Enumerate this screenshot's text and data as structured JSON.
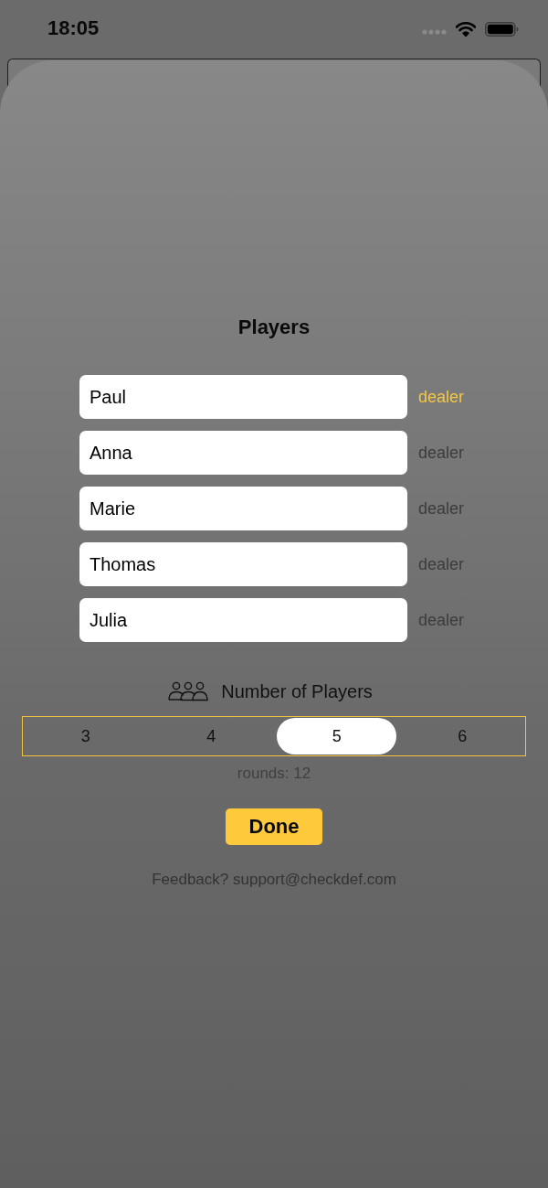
{
  "status_bar": {
    "time": "18:05"
  },
  "title": "Players",
  "players": [
    {
      "name": "Paul",
      "dealer_label": "dealer",
      "selected": true
    },
    {
      "name": "Anna",
      "dealer_label": "dealer",
      "selected": false
    },
    {
      "name": "Marie",
      "dealer_label": "dealer",
      "selected": false
    },
    {
      "name": "Thomas",
      "dealer_label": "dealer",
      "selected": false
    },
    {
      "name": "Julia",
      "dealer_label": "dealer",
      "selected": false
    }
  ],
  "player_count": {
    "label": "Number of Players",
    "options": [
      {
        "label": "3",
        "selected": false
      },
      {
        "label": "4",
        "selected": false
      },
      {
        "label": "5",
        "selected": true
      },
      {
        "label": "6",
        "selected": false
      }
    ]
  },
  "rounds": "rounds: 12",
  "done_button": "Done",
  "feedback": "Feedback? support@checkdef.com"
}
